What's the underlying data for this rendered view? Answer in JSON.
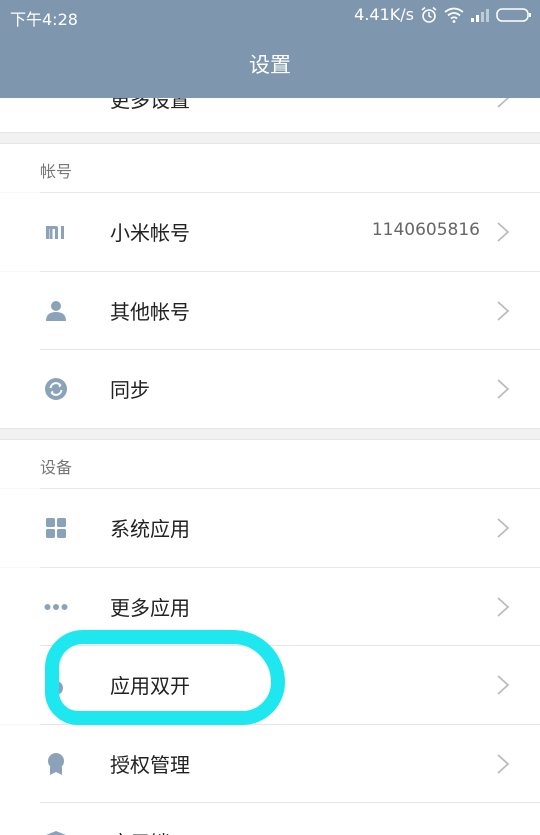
{
  "status_bar": {
    "time": "下午4:28",
    "network_speed": "4.41K/s"
  },
  "header": {
    "title": "设置"
  },
  "top_partial_item": {
    "label": "更多设置"
  },
  "sections": [
    {
      "title": "帐号",
      "items": [
        {
          "label": "小米帐号",
          "value": "1140605816",
          "icon": "mi-logo-icon"
        },
        {
          "label": "其他帐号",
          "icon": "person-icon"
        },
        {
          "label": "同步",
          "icon": "sync-icon"
        }
      ]
    },
    {
      "title": "设备",
      "items": [
        {
          "label": "系统应用",
          "icon": "grid-icon"
        },
        {
          "label": "更多应用",
          "icon": "dots-icon"
        },
        {
          "label": "应用双开",
          "icon": "dual-app-icon"
        },
        {
          "label": "授权管理",
          "icon": "badge-icon"
        },
        {
          "label": "应用锁",
          "icon": "shield-icon"
        }
      ]
    }
  ],
  "colors": {
    "header": "#7f97ae",
    "icon": "#8ba3b8",
    "annotation": "#1fe7ef"
  }
}
